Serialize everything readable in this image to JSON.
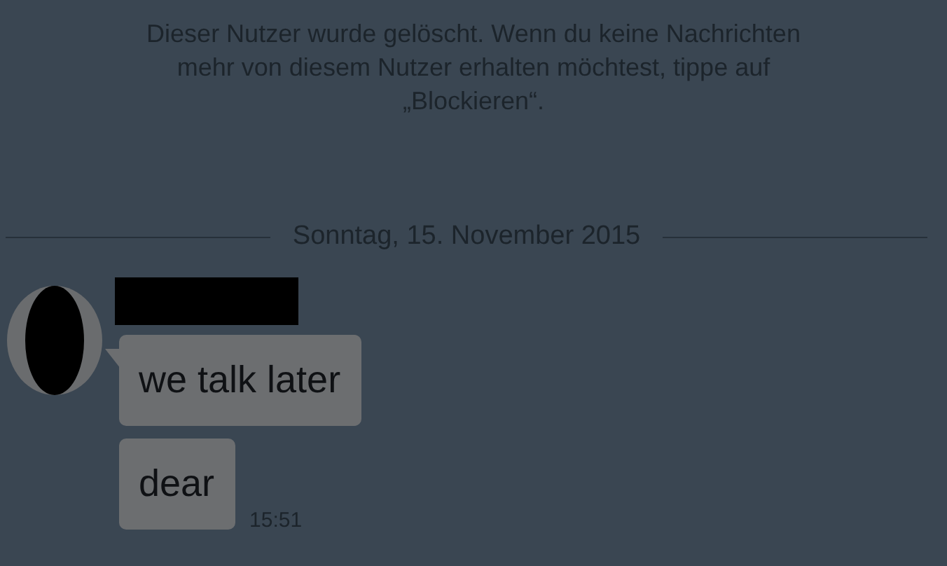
{
  "notice": "Dieser Nutzer wurde gelöscht. Wenn du keine Nachrichten mehr von diesem Nutzer erhalten möchtest, tippe auf „Blockieren“.",
  "date_divider": "Sonntag, 15. November 2015",
  "messages": [
    {
      "text": "we talk later"
    },
    {
      "text": "dear",
      "time": "15:51"
    }
  ]
}
